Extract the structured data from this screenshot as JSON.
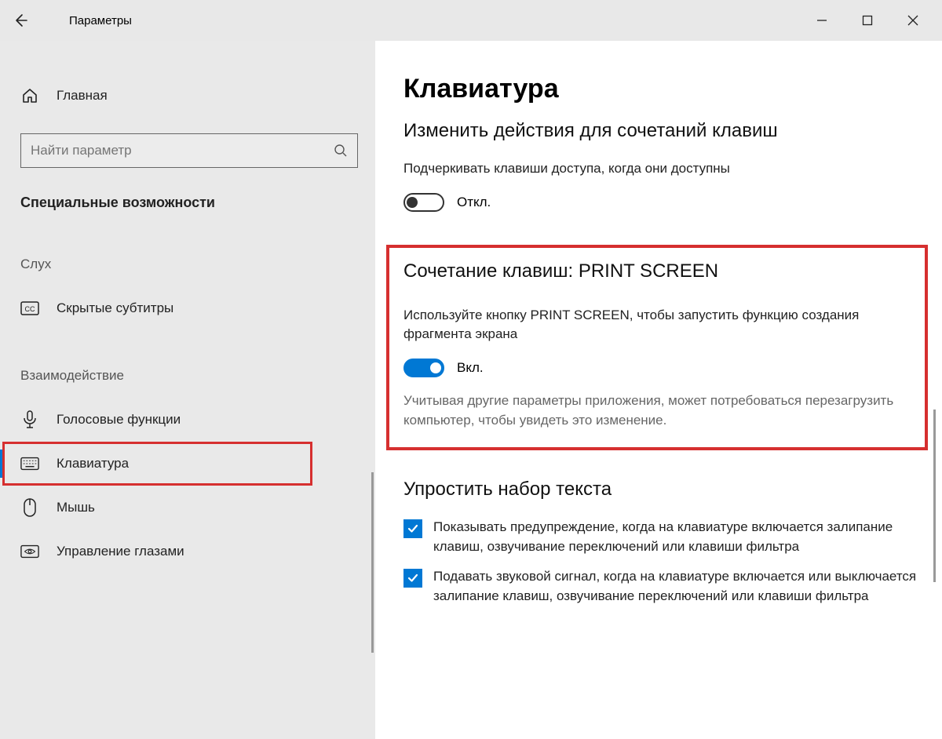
{
  "titlebar": {
    "title": "Параметры"
  },
  "sidebar": {
    "home_label": "Главная",
    "search_placeholder": "Найти параметр",
    "section_header": "Специальные возможности",
    "group_hearing": "Слух",
    "group_interaction": "Взаимодействие",
    "items": {
      "captions": "Скрытые субтитры",
      "speech": "Голосовые функции",
      "keyboard": "Клавиатура",
      "mouse": "Мышь",
      "eye": "Управление глазами"
    }
  },
  "content": {
    "page_title": "Клавиатура",
    "shortcuts": {
      "title": "Изменить действия для сочетаний клавиш",
      "desc": "Подчеркивать клавиши доступа, когда они доступны",
      "state": "Откл."
    },
    "printscreen": {
      "title": "Сочетание клавиш: PRINT SCREEN",
      "desc": "Используйте кнопку PRINT SCREEN, чтобы запустить функцию создания фрагмента экрана",
      "state": "Вкл.",
      "note": "Учитывая другие параметры приложения, может потребоваться перезагрузить компьютер, чтобы увидеть это изменение."
    },
    "simplify": {
      "title": "Упростить набор текста",
      "check1": "Показывать предупреждение, когда на клавиатуре включается залипание клавиш, озвучивание переключений или клавиши фильтра",
      "check2": "Подавать звуковой сигнал, когда на клавиатуре включается или выключается залипание клавиш, озвучивание переключений или клавиши фильтра"
    }
  }
}
